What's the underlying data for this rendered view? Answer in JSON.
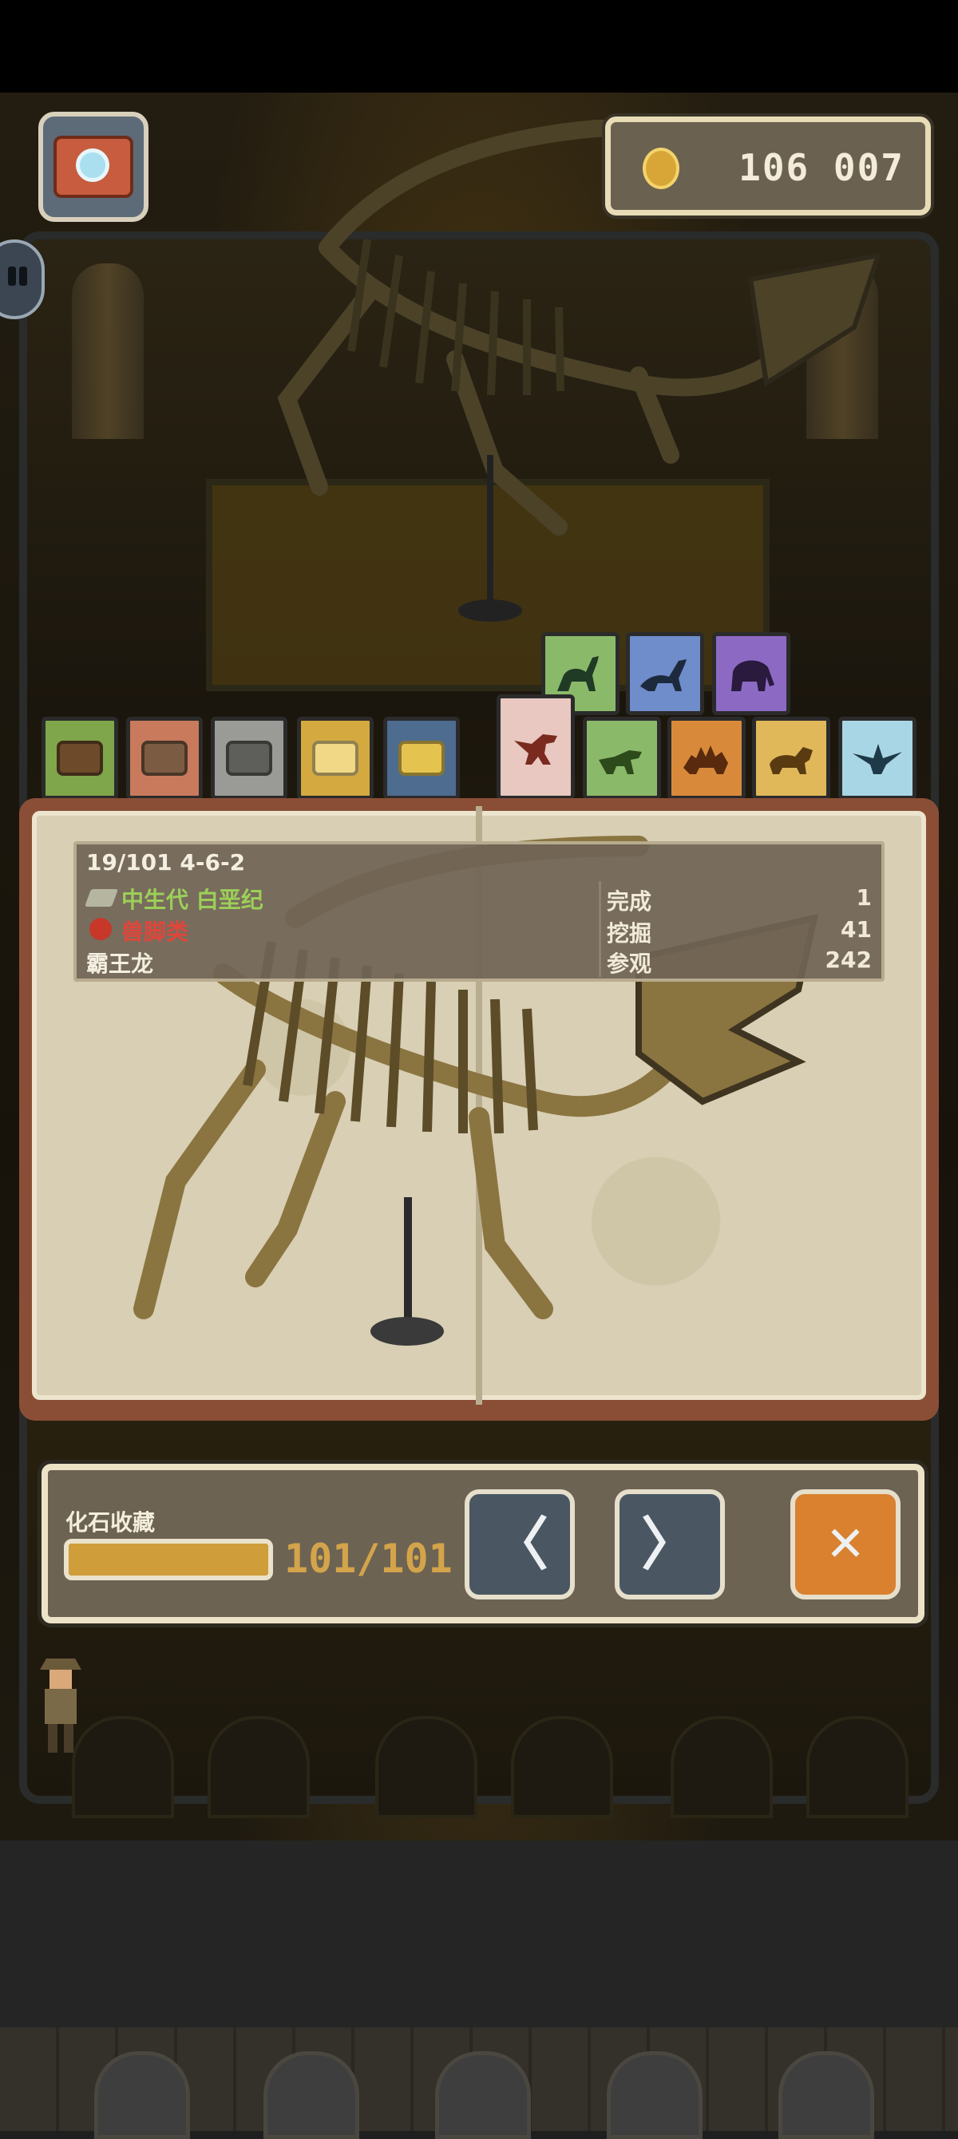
{
  "currency": {
    "coin_count": "106 007"
  },
  "categories": [
    {
      "name": "wood-tab",
      "color": "#7fa64a",
      "inner": "#6c4a2a"
    },
    {
      "name": "clay-tab",
      "color": "#c97a5c",
      "inner": "#7b5b42"
    },
    {
      "name": "stone-tab",
      "color": "#9a9a96",
      "inner": "#5e5e5a"
    },
    {
      "name": "gold-tab",
      "color": "#d4a93f",
      "inner": "#f0d886"
    },
    {
      "name": "gem-tab",
      "color": "#4d6c8f",
      "inner": "#e5c34f"
    }
  ],
  "dino_tabs_top": [
    {
      "name": "sauropod-tab",
      "color": "#8bb96a"
    },
    {
      "name": "long-neck-tab",
      "color": "#6f8ccb"
    },
    {
      "name": "mammoth-tab",
      "color": "#8c6ac4"
    }
  ],
  "dino_tabs_bottom": [
    {
      "name": "theropod-tab-selected",
      "color": "#e8c8c0"
    },
    {
      "name": "small-dino-tab",
      "color": "#8bb96a"
    },
    {
      "name": "stegosaur-tab",
      "color": "#d88a3a"
    },
    {
      "name": "triceratops-tab",
      "color": "#e0b85a"
    },
    {
      "name": "pterosaur-tab",
      "color": "#a9d6e4"
    }
  ],
  "fossil": {
    "index": "19/101 4-6-2",
    "era": "中生代 白垩纪",
    "type": "兽脚类",
    "name": "霸王龙",
    "stats": [
      {
        "label": "完成",
        "value": "1"
      },
      {
        "label": "挖掘",
        "value": "41"
      },
      {
        "label": "参观",
        "value": "242"
      }
    ]
  },
  "collection": {
    "label": "化石收藏",
    "progress_text": "101/101",
    "progress_fraction": 1.0
  },
  "buttons": {
    "prev": "〈",
    "next": "〉",
    "close": "✕"
  }
}
